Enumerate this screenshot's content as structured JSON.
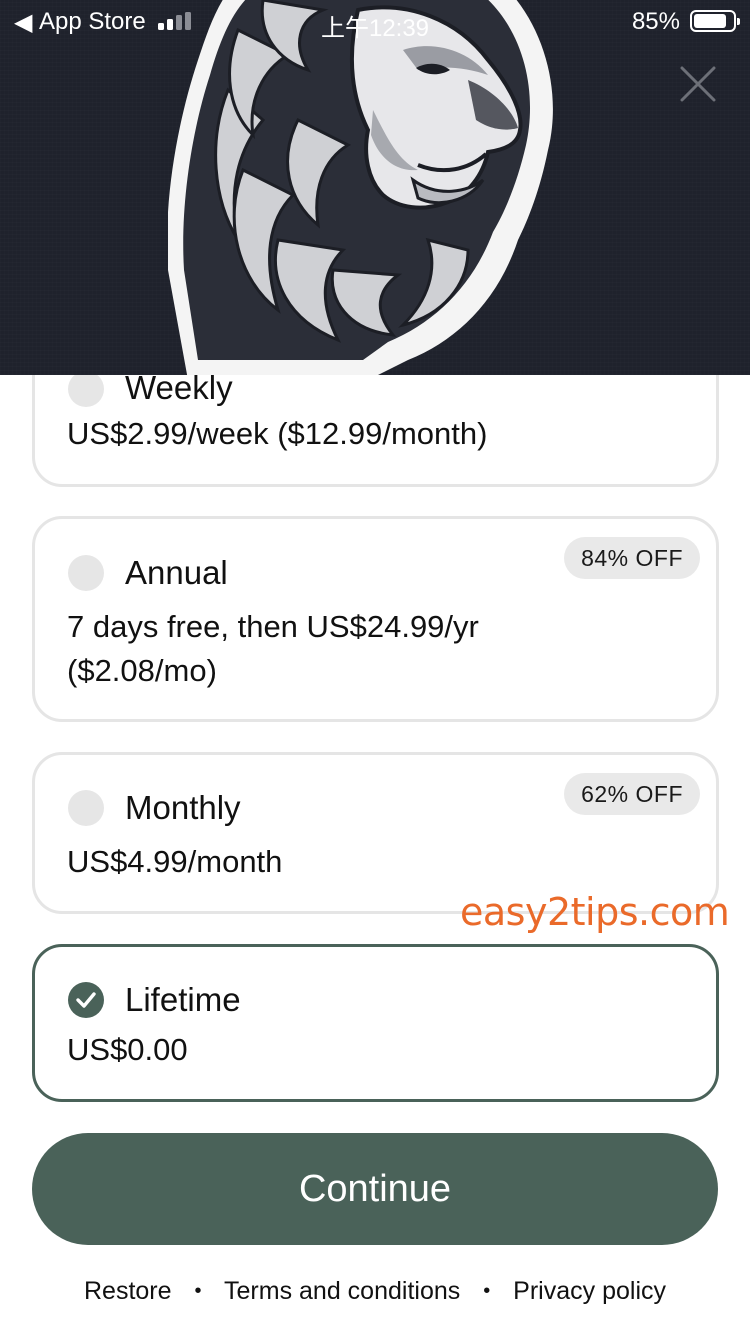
{
  "status_bar": {
    "back_app": "App Store",
    "time": "上午12:39",
    "battery": "85%",
    "battery_level": 0.85
  },
  "hero": {
    "image": "lion-head-illustration",
    "close_icon": "close-icon"
  },
  "plans": [
    {
      "id": "weekly",
      "name": "Weekly",
      "price": "US$2.99/week ($12.99/month)",
      "badge": "",
      "selected": false
    },
    {
      "id": "annual",
      "name": "Annual",
      "price_line1": "7 days free, then US$24.99/yr",
      "price_line2": "($2.08/mo)",
      "badge": "84% OFF",
      "selected": false
    },
    {
      "id": "monthly",
      "name": "Monthly",
      "price": "US$4.99/month",
      "badge": "62% OFF",
      "selected": false
    },
    {
      "id": "lifetime",
      "name": "Lifetime",
      "price": "US$0.00",
      "badge": "",
      "selected": true
    }
  ],
  "watermark": "easy2tips.com",
  "continue_label": "Continue",
  "footer": {
    "restore": "Restore",
    "terms": "Terms and conditions",
    "privacy": "Privacy policy",
    "separator": "•"
  },
  "colors": {
    "accent": "#4a6259",
    "header_bg": "#1f222c",
    "watermark": "#ea6a2a",
    "badge_bg": "#e9e9e9"
  }
}
